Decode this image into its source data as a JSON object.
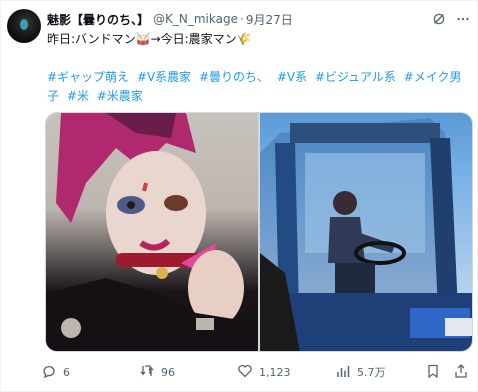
{
  "tweet": {
    "display_name": "魅影【曇りのち、】",
    "handle": "@K_N_mikage",
    "separator": "·",
    "date": "9月27日",
    "text": "昨日:バンドマン🥁→今日:農家マン🌾",
    "hashtags": [
      "#ギャップ萌え",
      "#V系農家",
      "#曇りのち、",
      "#V系",
      "#ビジュアル系",
      "#メイク男子",
      "#米",
      "#米農家"
    ]
  },
  "stats": {
    "replies": "6",
    "retweets": "96",
    "likes": "1,123",
    "views": "5.7万"
  },
  "icons": [
    "grok-icon",
    "more-icon",
    "reply-icon",
    "retweet-icon",
    "like-icon",
    "views-icon",
    "bookmark-icon",
    "share-icon"
  ],
  "colors": {
    "link": "#1d9bf0",
    "secondary": "#536471",
    "text": "#0f1419"
  }
}
